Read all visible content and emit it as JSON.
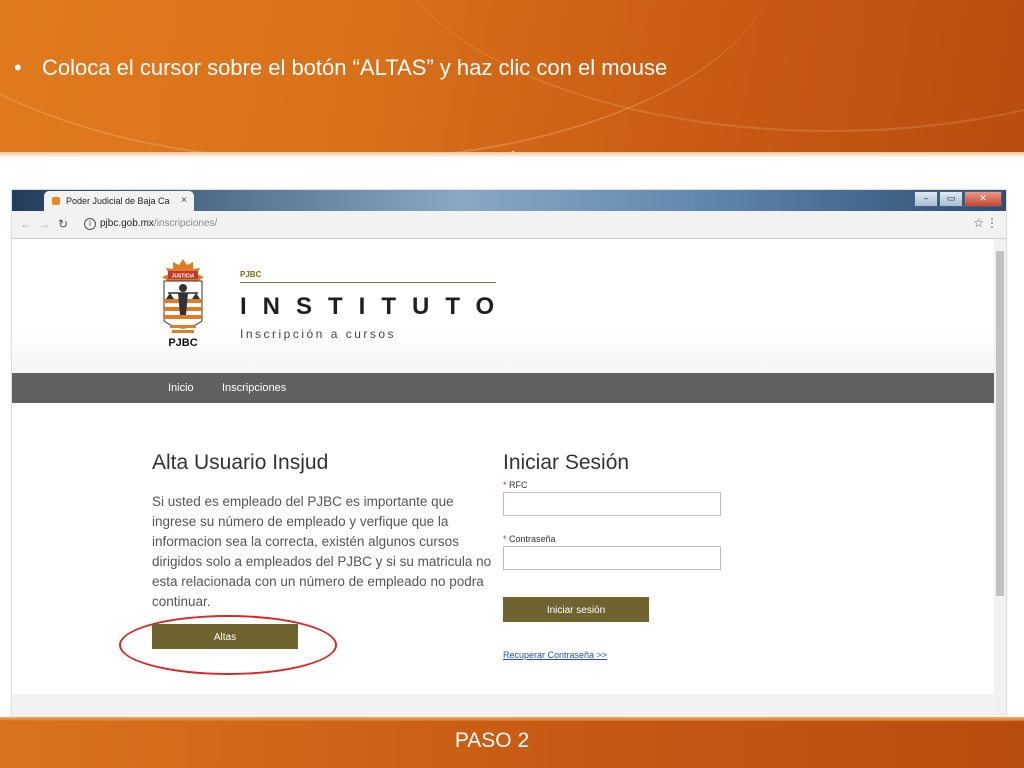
{
  "slide": {
    "bullet_glyph": "•",
    "instruction": "Coloca el cursor sobre el botón “ALTAS” y haz clic con el mouse",
    "footer_label": "PASO 2",
    "accent_color": "#d9711a"
  },
  "browser": {
    "tab_title": "Poder Judicial de Baja Ca",
    "tab_close_glyph": "×",
    "url_host": "pjbc.gob.mx",
    "url_path": "/inscripciones/",
    "window_controls": [
      "minimize",
      "restore",
      "close"
    ]
  },
  "site": {
    "logo_caption": "PJBC",
    "logo_banner_text": "JUSTICIA",
    "small_label": "PJBC",
    "title": "INSTITUTO",
    "subtitle": "Inscripción a cursos",
    "nav": [
      "Inicio",
      "Inscripciones"
    ],
    "brand_color": "#6f6430"
  },
  "alta": {
    "title": "Alta Usuario Insjud",
    "body": "Si usted es empleado del PJBC es importante que ingrese su número de empleado y verfique que la informacion sea la correcta, existén algunos cursos dirigidos solo a empleados del PJBC y si su matricula no esta relacionada con un número de empleado no podra continuar.",
    "button_label": "Altas",
    "highlight_color": "#d12a2a"
  },
  "login": {
    "title": "Iniciar Sesión",
    "required_mark": "*",
    "rfc_label": "RFC",
    "rfc_value": "",
    "password_label": "Contraseña",
    "password_value": "",
    "button_label": "Iniciar sesión",
    "recover_link": "Recuperar Contraseña >>"
  }
}
